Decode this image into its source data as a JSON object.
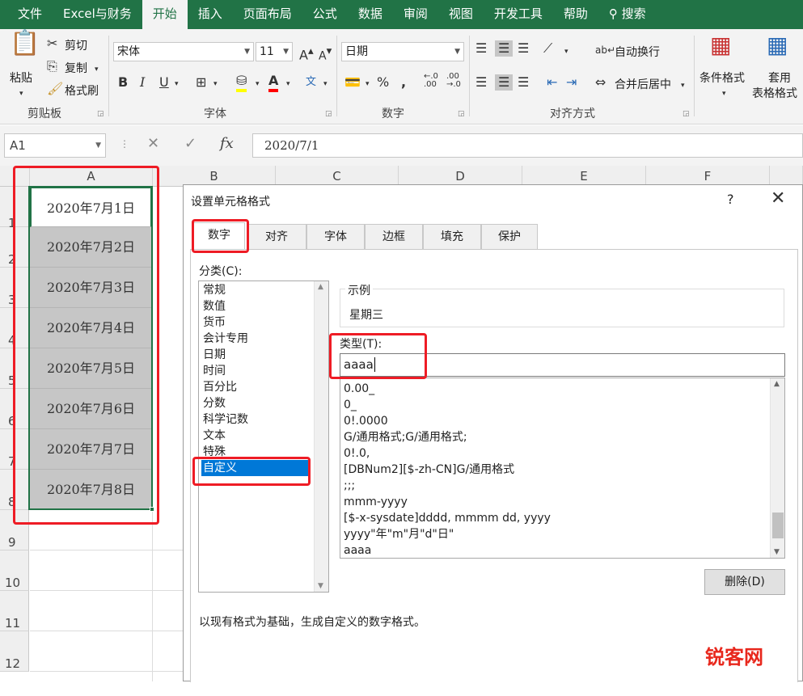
{
  "ribbon_tabs": [
    "文件",
    "Excel与财务",
    "开始",
    "插入",
    "页面布局",
    "公式",
    "数据",
    "审阅",
    "视图",
    "开发工具",
    "帮助"
  ],
  "search_label": "搜索",
  "clipboard": {
    "paste": "粘贴",
    "cut": "剪切",
    "copy": "复制",
    "format_painter": "格式刷",
    "group": "剪贴板"
  },
  "font": {
    "name": "宋体",
    "size": "11",
    "group": "字体",
    "increase": "A",
    "decrease": "A"
  },
  "number": {
    "format": "日期",
    "group": "数字"
  },
  "alignment": {
    "wrap": "自动换行",
    "merge": "合并后居中",
    "group": "对齐方式"
  },
  "styles": {
    "conditional": "条件格式",
    "table_line1": "套用",
    "table_line2": "表格格式"
  },
  "namebox": "A1",
  "formula": "2020/7/1",
  "columns": [
    "A",
    "B",
    "C",
    "D",
    "E",
    "F"
  ],
  "rows": [
    "1",
    "2",
    "3",
    "4",
    "5",
    "6",
    "7",
    "8",
    "9",
    "10",
    "11",
    "12"
  ],
  "cells": [
    "2020年7月1日",
    "2020年7月2日",
    "2020年7月3日",
    "2020年7月4日",
    "2020年7月5日",
    "2020年7月6日",
    "2020年7月7日",
    "2020年7月8日"
  ],
  "dialog": {
    "title": "设置单元格格式",
    "help": "?",
    "tabs": [
      "数字",
      "对齐",
      "字体",
      "边框",
      "填充",
      "保护"
    ],
    "category_label": "分类(C):",
    "categories": [
      "常规",
      "数值",
      "货币",
      "会计专用",
      "日期",
      "时间",
      "百分比",
      "分数",
      "科学记数",
      "文本",
      "特殊",
      "自定义"
    ],
    "sample_label": "示例",
    "sample_value": "星期三",
    "type_label": "类型(T):",
    "type_value": "aaaa",
    "formats": [
      "0.00_",
      "0_",
      "0!.0000",
      "G/通用格式;G/通用格式;",
      "0!.0,",
      "[DBNum2][$-zh-CN]G/通用格式",
      ";;;",
      "mmm-yyyy",
      "[$-x-sysdate]dddd, mmmm dd, yyyy",
      "yyyy\"年\"m\"月\"d\"日\"",
      "aaaa"
    ],
    "delete_button": "删除(D)",
    "description": "以现有格式为基础，生成自定义的数字格式。"
  },
  "watermark": "锐客网",
  "colors": {
    "accent": "#217346",
    "selection": "#0078d7",
    "highlight": "#ee1c25"
  }
}
